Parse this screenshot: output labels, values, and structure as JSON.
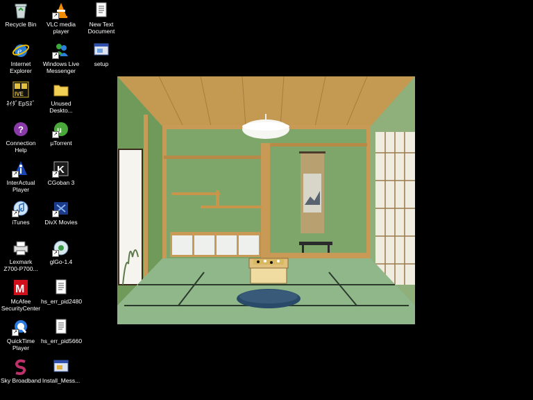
{
  "desktop_icons": [
    {
      "name": "recycle-bin-icon",
      "label": [
        "Recycle Bin"
      ]
    },
    {
      "name": "vlc-icon",
      "label": [
        "VLC media",
        "player"
      ]
    },
    {
      "name": "new-text-document-icon",
      "label": [
        "New Text",
        "Document"
      ]
    },
    {
      "name": "internet-explorer-icon",
      "label": [
        "Internet",
        "Explorer"
      ]
    },
    {
      "name": "windows-live-messenger-icon",
      "label": [
        "Windows Live",
        "Messenger"
      ]
    },
    {
      "name": "setup-icon",
      "label": [
        "setup"
      ]
    },
    {
      "name": "ive-app-icon",
      "label": [
        "ﾈｲﾀﾞEpSﾇﾞ"
      ]
    },
    {
      "name": "folder-icon",
      "label": [
        "Unused",
        "Deskto..."
      ]
    },
    {
      "name": "connection-help-icon",
      "label": [
        "Connection",
        "Help"
      ]
    },
    {
      "name": "utorrent-icon",
      "label": [
        "µTorrent"
      ]
    },
    {
      "name": "interactual-player-icon",
      "label": [
        "InterActual",
        "Player"
      ]
    },
    {
      "name": "cgoban-icon",
      "label": [
        "CGoban 3"
      ]
    },
    {
      "name": "itunes-icon",
      "label": [
        "iTunes"
      ]
    },
    {
      "name": "divx-movies-icon",
      "label": [
        "DivX Movies"
      ]
    },
    {
      "name": "lexmark-printer-icon",
      "label": [
        "Lexmark",
        "Z700-P700..."
      ]
    },
    {
      "name": "glgo-icon",
      "label": [
        "glGo-1.4"
      ]
    },
    {
      "name": "mcafee-icon",
      "label": [
        "McAfee",
        "SecurityCenter"
      ]
    },
    {
      "name": "text-file-icon",
      "label": [
        "hs_err_pid2480"
      ]
    },
    {
      "name": "quicktime-icon",
      "label": [
        "QuickTime",
        "Player"
      ]
    },
    {
      "name": "text-file-icon",
      "label": [
        "hs_err_pid5660"
      ]
    },
    {
      "name": "sky-broadband-icon",
      "label": [
        "Sky Broadband"
      ]
    },
    {
      "name": "installer-icon",
      "label": [
        "Install_Mess..."
      ]
    }
  ]
}
